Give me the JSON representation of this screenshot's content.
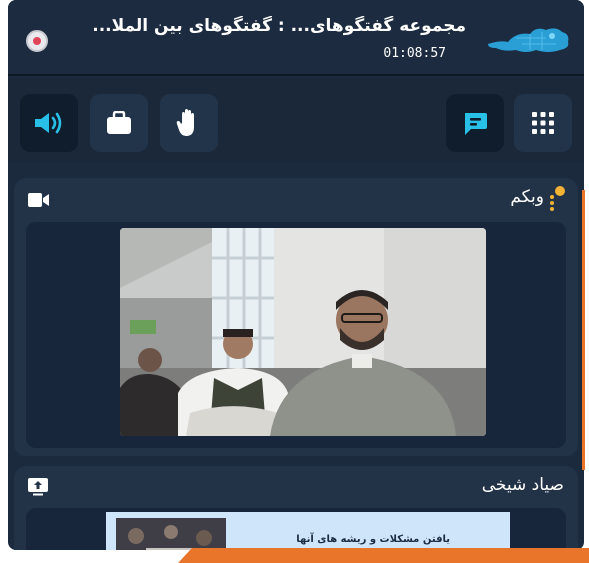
{
  "header": {
    "title": "مجموعه گفتگوهای... : گفتگوهای بین الملا...",
    "timer": "01:08:57",
    "logo": "brand-logo",
    "record_icon": "record-dot-icon"
  },
  "toolbar": {
    "buttons": [
      {
        "icon": "speaker-icon",
        "active": true
      },
      {
        "icon": "briefcase-icon",
        "active": false
      },
      {
        "icon": "raise-hand-icon",
        "active": false
      },
      {
        "icon": "chat-icon",
        "active": true
      },
      {
        "icon": "grid-menu-icon",
        "active": false
      }
    ]
  },
  "webcam_panel": {
    "title": "وبکم",
    "icon": "video-camera-icon",
    "menu_icon": "kebab-menu-icon"
  },
  "share_panel": {
    "title": "صیاد شیخی",
    "icon": "screen-share-icon",
    "slide_text": "یافتن مشکلات و ریشه های آنها"
  },
  "colors": {
    "background": "#1b2a3d",
    "panel": "#223247",
    "accent": "#29c0e8",
    "orange": "#e8752a"
  }
}
